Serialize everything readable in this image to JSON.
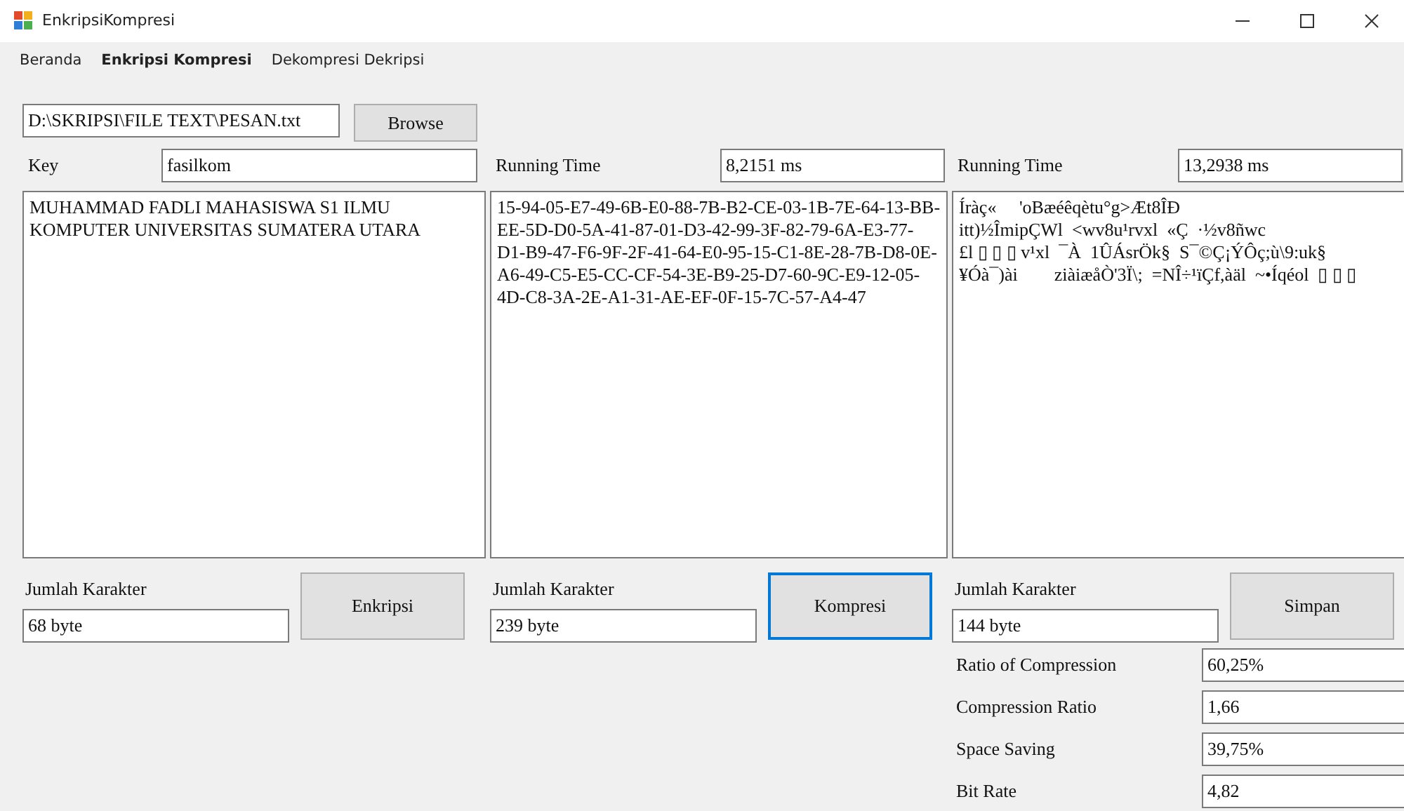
{
  "window": {
    "title": "EnkripsiKompresi"
  },
  "menu": [
    {
      "label": "Beranda",
      "selected": false
    },
    {
      "label": "Enkripsi Kompresi",
      "selected": true
    },
    {
      "label": "Dekompresi Dekripsi",
      "selected": false
    }
  ],
  "file": {
    "path": "D:\\SKRIPSI\\FILE TEXT\\PESAN.txt",
    "button": "Browse"
  },
  "panels": [
    {
      "label": "Key",
      "value": "fasilkom",
      "text": "MUHAMMAD FADLI MAHASISWA S1 ILMU KOMPUTER UNIVERSITAS SUMATERA UTARA",
      "count_label": "Jumlah Karakter",
      "count": "68 byte",
      "button": "Enkripsi",
      "focused": false
    },
    {
      "label": "Running Time",
      "value": "8,2151 ms",
      "text": "15-94-05-E7-49-6B-E0-88-7B-B2-CE-03-1B-7E-64-13-BB-EE-5D-D0-5A-41-87-01-D3-42-99-3F-82-79-6A-E3-77-D1-B9-47-F6-9F-2F-41-64-E0-95-15-C1-8E-28-7B-D8-0E-A6-49-C5-E5-CC-CF-54-3E-B9-25-D7-60-9C-E9-12-05-4D-C8-3A-2E-A1-31-AE-EF-0F-15-7C-57-A4-47",
      "count_label": "Jumlah Karakter",
      "count": "239 byte",
      "button": "Kompresi",
      "focused": true
    },
    {
      "label": "Running Time",
      "value": "13,2938 ms",
      "text": "Íràç«     'oBæéêqètu°g>Æt8ÎÐ\nitt)½ÎmipÇWl  <wv8u¹rvxl  «Ç  ·½v8ñwc\n£l ▯ ▯ ▯ v¹xl  ¯À  1ÛÁsrÖk§  S¯©Ç¡ÝÔç;ù\\9:uk§\n¥Óà¯)ài        ziàiæåÒ'3Ï\\;  =NÎ÷¹ïÇf,àäl  ~•Íqéol  ▯ ▯ ▯",
      "count_label": "Jumlah Karakter",
      "count": "144 byte",
      "button": "Simpan",
      "focused": false
    }
  ],
  "metrics": [
    {
      "label": "Ratio of Compression",
      "value": "60,25%"
    },
    {
      "label": "Compression Ratio",
      "value": "1,66"
    },
    {
      "label": "Space Saving",
      "value": "39,75%"
    },
    {
      "label": "Bit Rate",
      "value": "4,82"
    }
  ]
}
